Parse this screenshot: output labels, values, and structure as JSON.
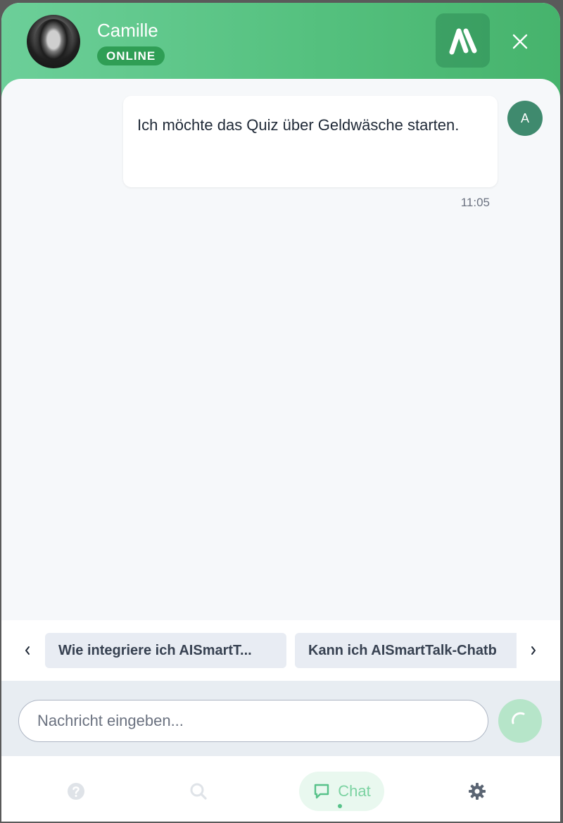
{
  "header": {
    "agent_name": "Camille",
    "status": "ONLINE",
    "brand_logo": "aismarttalk-logo"
  },
  "conversation": [
    {
      "sender_initial": "A",
      "text": "Ich möchte das Quiz über Geldwäsche starten.",
      "time": "11:05"
    }
  ],
  "suggestions": [
    "Wie integriere ich AISmartT...",
    "Kann ich AISmartTalk-Chatb"
  ],
  "input": {
    "placeholder": "Nachricht eingeben...",
    "value": ""
  },
  "nav": {
    "items": [
      {
        "icon": "help-icon",
        "label": ""
      },
      {
        "icon": "search-icon",
        "label": ""
      },
      {
        "icon": "chat-icon",
        "label": "Chat",
        "active": true
      },
      {
        "icon": "gear-icon",
        "label": ""
      }
    ]
  },
  "colors": {
    "header_start": "#6ccf99",
    "header_end": "#46b36c",
    "status_badge": "#2f9e55",
    "user_avatar": "#3f8a6e",
    "active_nav": "#7cd3a2"
  }
}
